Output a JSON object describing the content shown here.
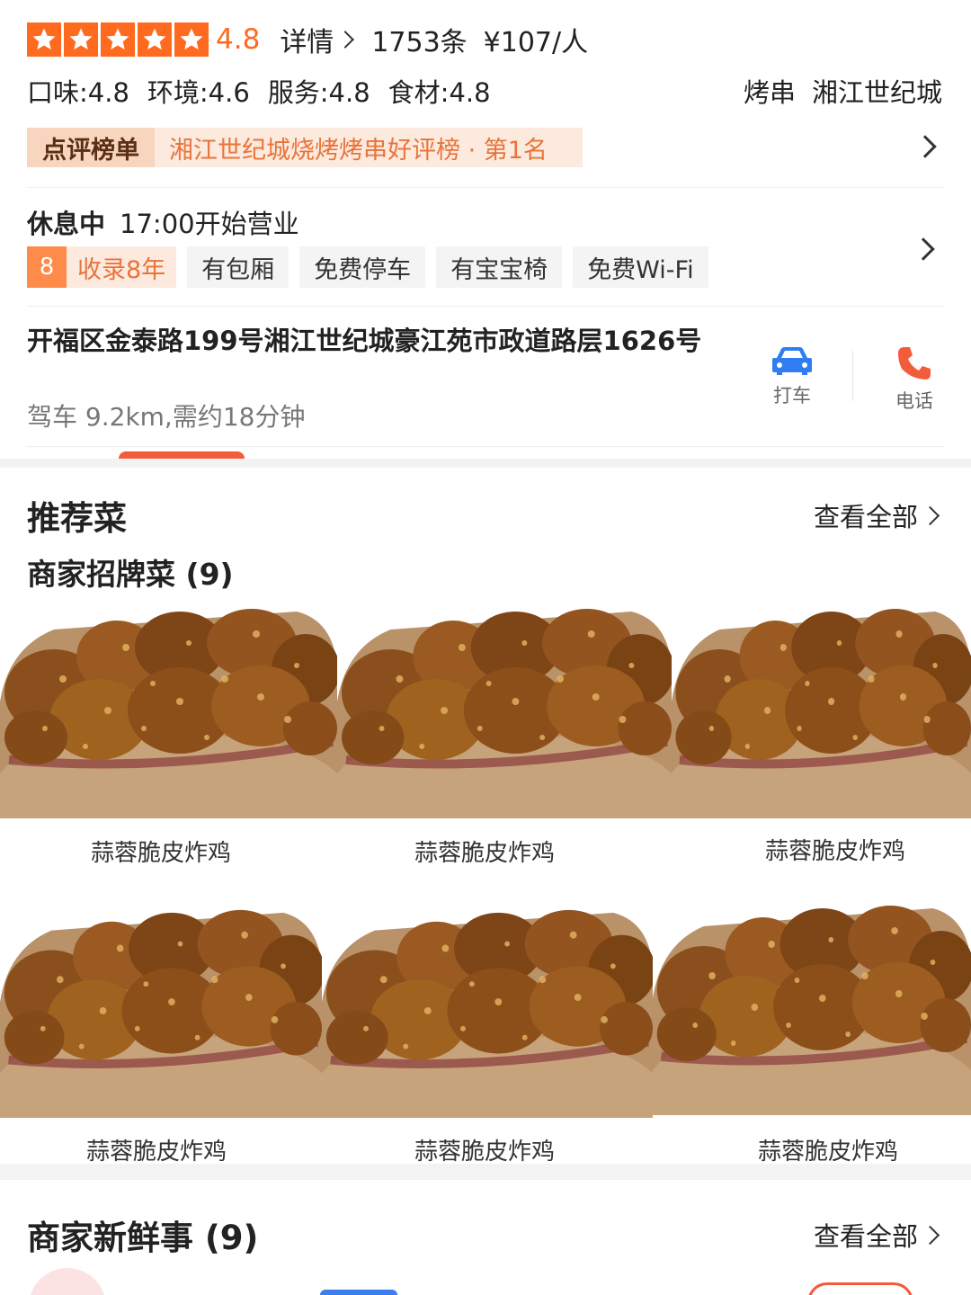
{
  "colors": {
    "accent": "#ff6a1e",
    "rank_bg": "#fdeadf",
    "rank_text": "#e8743a",
    "call": "#f25c3a",
    "taxi": "#2f7df0"
  },
  "rating": {
    "stars": 5,
    "score": "4.8",
    "detail_label": "详情",
    "review_count": "1753条",
    "price": "¥107/人"
  },
  "scores": [
    {
      "label": "口味:4.8"
    },
    {
      "label": "环境:4.6"
    },
    {
      "label": "服务:4.8"
    },
    {
      "label": "食材:4.8"
    }
  ],
  "tags": [
    "烤串",
    "湘江世纪城"
  ],
  "rank": {
    "badge": "点评榜单",
    "text": "湘江世纪城烧烤烤串好评榜 · 第1名"
  },
  "status": {
    "state": "休息中",
    "hours": "17:00开始营业"
  },
  "amenities": {
    "years_number": "8",
    "years_label": "收录8年",
    "items": [
      "有包厢",
      "免费停车",
      "有宝宝椅",
      "免费Wi-Fi"
    ]
  },
  "address": {
    "text": "开福区金泰路199号湘江世纪城豪江苑市政道路层1626号",
    "drive": "驾车 9.2km,需约18分钟"
  },
  "actions": {
    "taxi_label": "打车",
    "call_label": "电话"
  },
  "recommend": {
    "title": "推荐菜",
    "view_all": "查看全部",
    "signature_title": "商家招牌菜 (9)",
    "dishes": [
      {
        "name": "蒜蓉脆皮炸鸡"
      },
      {
        "name": "蒜蓉脆皮炸鸡"
      },
      {
        "name": "蒜蓉脆皮炸鸡"
      },
      {
        "name": "蒜蓉脆皮炸鸡"
      },
      {
        "name": "蒜蓉脆皮炸鸡"
      },
      {
        "name": "蒜蓉脆皮炸鸡"
      }
    ]
  },
  "news": {
    "title": "商家新鲜事 (9)",
    "view_all": "查看全部"
  }
}
